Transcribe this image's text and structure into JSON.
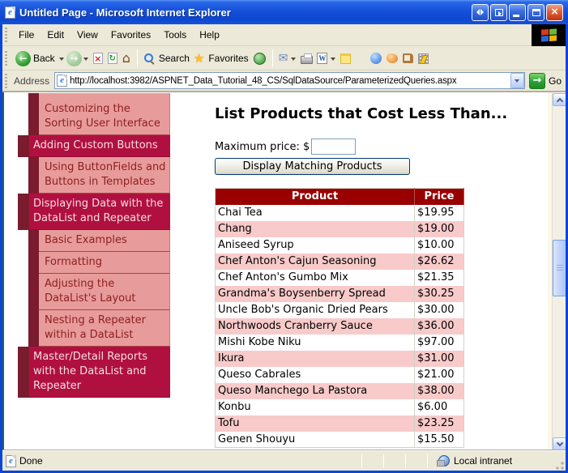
{
  "window": {
    "title": "Untitled Page - Microsoft Internet Explorer"
  },
  "menu": {
    "items": [
      "File",
      "Edit",
      "View",
      "Favorites",
      "Tools",
      "Help"
    ]
  },
  "toolbar": {
    "back": "Back",
    "search": "Search",
    "favorites": "Favorites"
  },
  "address": {
    "label": "Address",
    "url": "http://localhost:3982/ASPNET_Data_Tutorial_48_CS/SqlDataSource/ParameterizedQueries.aspx",
    "go": "Go"
  },
  "sidebar": {
    "items": [
      {
        "label": "",
        "level": 2,
        "partial": true
      },
      {
        "label": "Customizing the Sorting User Interface",
        "level": 2
      },
      {
        "label": "Adding Custom Buttons",
        "level": 1
      },
      {
        "label": "Using ButtonFields and Buttons in Templates",
        "level": 2
      },
      {
        "label": "Displaying Data with the DataList and Repeater",
        "level": 1
      },
      {
        "label": "Basic Examples",
        "level": 2
      },
      {
        "label": "Formatting",
        "level": 2
      },
      {
        "label": "Adjusting the DataList's Layout",
        "level": 2
      },
      {
        "label": "Nesting a Repeater within a DataList",
        "level": 2
      },
      {
        "label": "Master/Detail Reports with the DataList and Repeater",
        "level": 1
      }
    ]
  },
  "main": {
    "heading": "List Products that Cost Less Than...",
    "price_label": "Maximum price: $",
    "price_value": "",
    "button": "Display Matching Products"
  },
  "table": {
    "columns": [
      "Product",
      "Price"
    ],
    "rows": [
      [
        "Chai Tea",
        "$19.95"
      ],
      [
        "Chang",
        "$19.00"
      ],
      [
        "Aniseed Syrup",
        "$10.00"
      ],
      [
        "Chef Anton's Cajun Seasoning",
        "$26.62"
      ],
      [
        "Chef Anton's Gumbo Mix",
        "$21.35"
      ],
      [
        "Grandma's Boysenberry Spread",
        "$30.25"
      ],
      [
        "Uncle Bob's Organic Dried Pears",
        "$30.00"
      ],
      [
        "Northwoods Cranberry Sauce",
        "$36.00"
      ],
      [
        "Mishi Kobe Niku",
        "$97.00"
      ],
      [
        "Ikura",
        "$31.00"
      ],
      [
        "Queso Cabrales",
        "$21.00"
      ],
      [
        "Queso Manchego La Pastora",
        "$38.00"
      ],
      [
        "Konbu",
        "$6.00"
      ],
      [
        "Tofu",
        "$23.25"
      ],
      [
        "Genen Shouyu",
        "$15.50"
      ]
    ]
  },
  "status": {
    "left": "Done",
    "zone": "Local intranet"
  },
  "colors": {
    "table_header": "#990000",
    "table_alt_row": "#f8caca",
    "nav_parent": "#b01040",
    "nav_child": "#e89b9b",
    "nav_indent": "#7a1b2e",
    "chrome": "#ece9d8",
    "frame_blue": "#0a46d8"
  }
}
